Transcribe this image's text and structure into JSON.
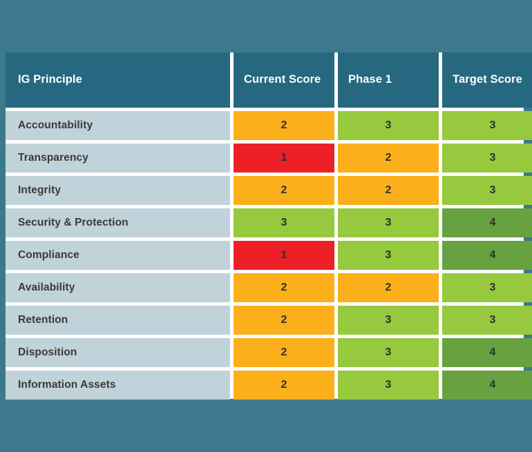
{
  "theme": {
    "page_background": "#3d798c",
    "card_background": "#ffffff",
    "header_background": "#266880",
    "header_text": "#ffffff",
    "principle_background": "#c0d2da",
    "principle_text": "#3a3a3a",
    "score_text": "#2f2f2f",
    "score_red": "#ed2028",
    "score_orange": "#fbaf1a",
    "score_green": "#96c93d",
    "score_dark_green": "#68a240"
  },
  "table": {
    "headers": [
      "IG Principle",
      "Current Score",
      "Phase 1",
      "Target Score"
    ],
    "rows": [
      {
        "principle": "Accountability",
        "current_score": "2",
        "current_level": "orange",
        "phase_1": "3",
        "phase_1_level": "green",
        "target_score": "3",
        "target_level": "green"
      },
      {
        "principle": "Transparency",
        "current_score": "1",
        "current_level": "red",
        "phase_1": "2",
        "phase_1_level": "orange",
        "target_score": "3",
        "target_level": "green"
      },
      {
        "principle": "Integrity",
        "current_score": "2",
        "current_level": "orange",
        "phase_1": "2",
        "phase_1_level": "orange",
        "target_score": "3",
        "target_level": "green"
      },
      {
        "principle": "Security & Protection",
        "current_score": "3",
        "current_level": "green",
        "phase_1": "3",
        "phase_1_level": "green",
        "target_score": "4",
        "target_level": "dkgreen"
      },
      {
        "principle": "Compliance",
        "current_score": "1",
        "current_level": "red",
        "phase_1": "3",
        "phase_1_level": "green",
        "target_score": "4",
        "target_level": "dkgreen"
      },
      {
        "principle": "Availability",
        "current_score": "2",
        "current_level": "orange",
        "phase_1": "2",
        "phase_1_level": "orange",
        "target_score": "3",
        "target_level": "green"
      },
      {
        "principle": "Retention",
        "current_score": "2",
        "current_level": "orange",
        "phase_1": "3",
        "phase_1_level": "green",
        "target_score": "3",
        "target_level": "green"
      },
      {
        "principle": "Disposition",
        "current_score": "2",
        "current_level": "orange",
        "phase_1": "3",
        "phase_1_level": "green",
        "target_score": "4",
        "target_level": "dkgreen"
      },
      {
        "principle": "Information Assets",
        "current_score": "2",
        "current_level": "orange",
        "phase_1": "3",
        "phase_1_level": "green",
        "target_score": "4",
        "target_level": "dkgreen"
      }
    ]
  },
  "chart_data": {
    "type": "heatmap",
    "title": "",
    "xlabel": "",
    "ylabel": "",
    "categories": [
      "Accountability",
      "Transparency",
      "Integrity",
      "Security & Protection",
      "Compliance",
      "Availability",
      "Retention",
      "Disposition",
      "Information Assets"
    ],
    "series": [
      {
        "name": "Current Score",
        "values": [
          2,
          1,
          2,
          3,
          1,
          2,
          2,
          2,
          2
        ]
      },
      {
        "name": "Phase 1",
        "values": [
          3,
          2,
          2,
          3,
          3,
          2,
          3,
          3,
          3
        ]
      },
      {
        "name": "Target Score",
        "values": [
          3,
          3,
          3,
          4,
          4,
          3,
          3,
          4,
          4
        ]
      }
    ],
    "value_range": [
      1,
      4
    ],
    "color_scale": {
      "1": "#ed2028",
      "2": "#fbaf1a",
      "3": "#96c93d",
      "4": "#68a240"
    },
    "legend": "none",
    "grid": false
  }
}
